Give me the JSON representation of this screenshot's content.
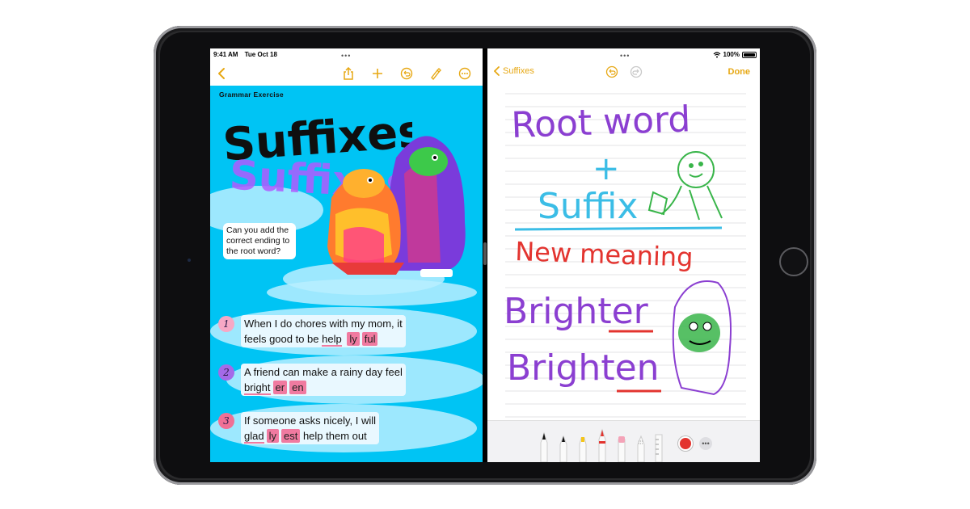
{
  "status_bar": {
    "time": "9:41 AM",
    "date": "Tue Oct 18",
    "battery": "100%"
  },
  "left_app": {
    "doc_label": "Grammar Exercise",
    "title_art_text": "Suffixes",
    "question": "Can you add the correct ending to the root word?",
    "exercises": [
      {
        "number": "1",
        "line1": "When I do chores with my mom, it",
        "line2_prefix": "feels good to be ",
        "root": "help",
        "options": [
          "ly",
          "ful"
        ],
        "suffix_text": "",
        "num_color": "#f27aa7"
      },
      {
        "number": "2",
        "line1": "A friend can make a rainy day feel",
        "line2_prefix": "",
        "root": "bright",
        "options": [
          "er",
          "en"
        ],
        "suffix_text": "",
        "num_color": "#8a3ad8"
      },
      {
        "number": "3",
        "line1": "If someone asks nicely, I will",
        "line2_prefix": "",
        "root": "glad",
        "options": [
          "ly",
          "est"
        ],
        "suffix_text": "help them out",
        "num_color": "#ec4a70"
      }
    ]
  },
  "right_app": {
    "back_label": "Suffixes",
    "done_label": "Done",
    "handwriting": {
      "line1": "Root word",
      "plus": "+",
      "line2": "Suffix",
      "line3": "New meaning",
      "line4": "Brighter",
      "line5": "Brighten"
    }
  },
  "colors": {
    "accent": "#e7a814",
    "left_bg": "#00c4f4",
    "chip": "#f07aa0",
    "ink_purple": "#8b3fd1",
    "ink_blue": "#3bbde6",
    "ink_red": "#e3342f",
    "ink_green": "#39b54a"
  }
}
